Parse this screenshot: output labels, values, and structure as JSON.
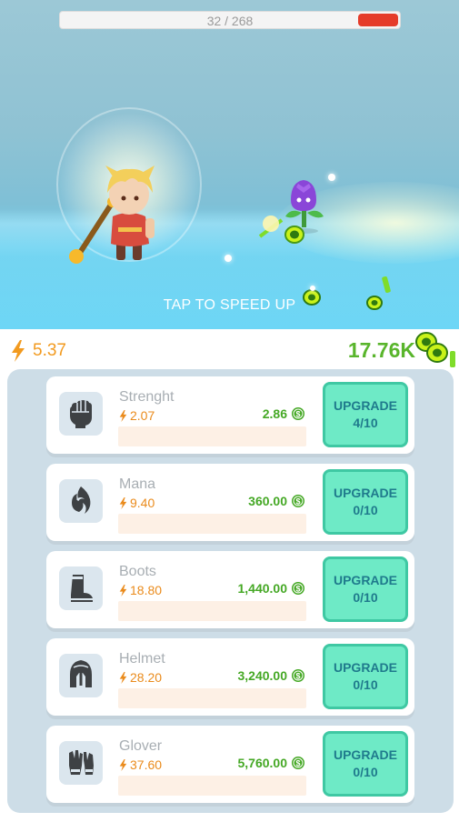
{
  "game": {
    "hp_text": "32 / 268",
    "hp_fraction": 0.12,
    "tap_hint": "TAP TO SPEED UP"
  },
  "stats": {
    "energy": "5.37",
    "gold": "17.76K"
  },
  "upgrades": [
    {
      "name": "Strenght",
      "power": "2.07",
      "cost": "2.86",
      "button": "UPGRADE",
      "level": "4/10",
      "icon": "fist-icon"
    },
    {
      "name": "Mana",
      "power": "9.40",
      "cost": "360.00",
      "button": "UPGRADE",
      "level": "0/10",
      "icon": "mana-flame-icon"
    },
    {
      "name": "Boots",
      "power": "18.80",
      "cost": "1,440.00",
      "button": "UPGRADE",
      "level": "0/10",
      "icon": "boot-icon"
    },
    {
      "name": "Helmet",
      "power": "28.20",
      "cost": "3,240.00",
      "button": "UPGRADE",
      "level": "0/10",
      "icon": "spartan-helmet-icon"
    },
    {
      "name": "Glover",
      "power": "37.60",
      "cost": "5,760.00",
      "button": "UPGRADE",
      "level": "0/10",
      "icon": "gloves-icon"
    }
  ],
  "colors": {
    "energy": "#f29a1f",
    "gold": "#59b52c",
    "upgrade_button": "#6eeac6",
    "hp_fill": "#e53c2a"
  }
}
